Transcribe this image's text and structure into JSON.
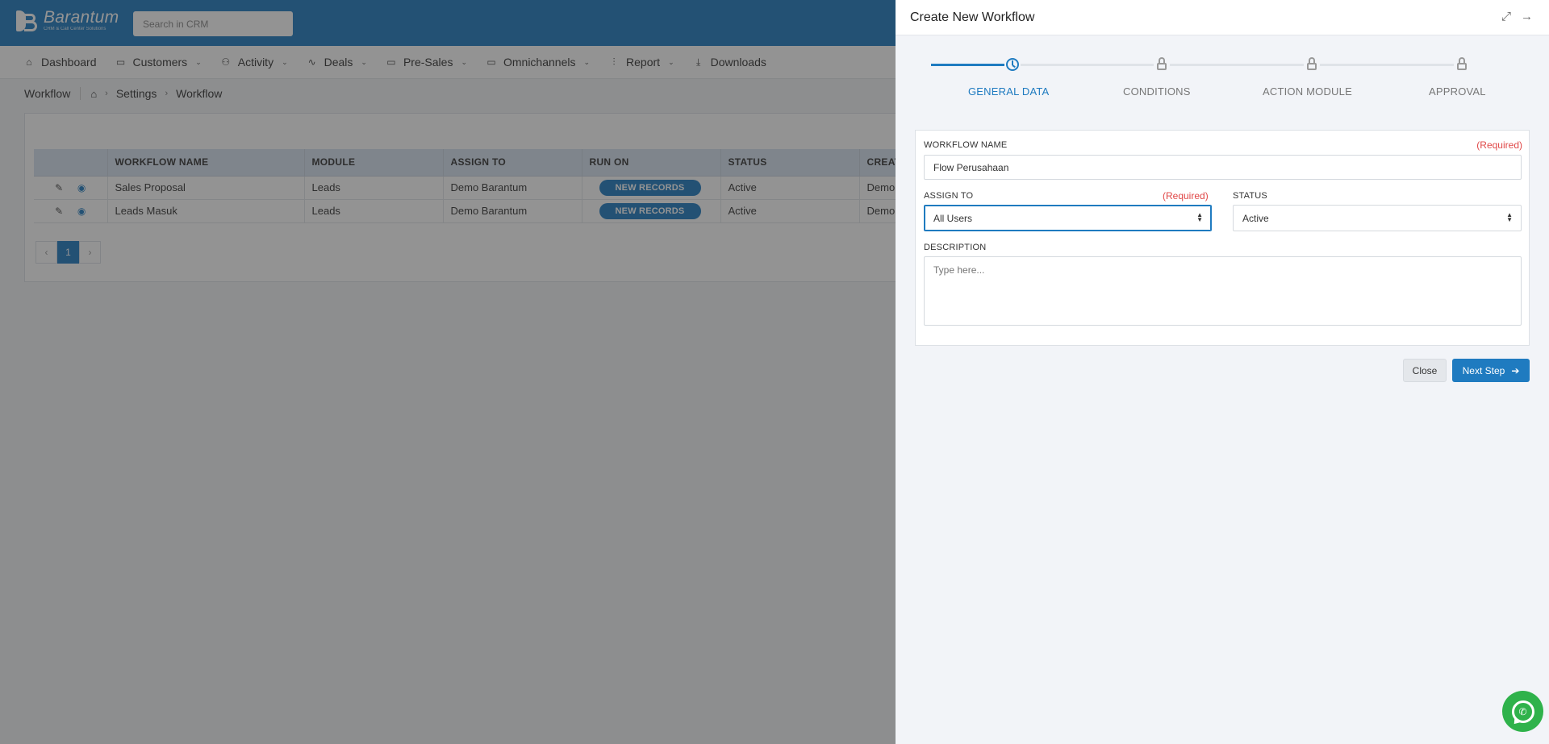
{
  "app": {
    "logo_name": "Barantum",
    "logo_tagline": "CRM & Call Center Solutions",
    "search_placeholder": "Search in CRM",
    "brand_color": "#1f7bc0"
  },
  "nav": [
    {
      "label": "Dashboard",
      "icon": "home-icon",
      "dropdown": false
    },
    {
      "label": "Customers",
      "icon": "folder-icon",
      "dropdown": true
    },
    {
      "label": "Activity",
      "icon": "users-icon",
      "dropdown": true
    },
    {
      "label": "Deals",
      "icon": "pulse-icon",
      "dropdown": true
    },
    {
      "label": "Pre-Sales",
      "icon": "folder-icon",
      "dropdown": true
    },
    {
      "label": "Omnichannels",
      "icon": "folder-icon",
      "dropdown": true
    },
    {
      "label": "Report",
      "icon": "bar-chart-icon",
      "dropdown": true
    },
    {
      "label": "Downloads",
      "icon": "download-icon",
      "dropdown": false
    }
  ],
  "breadcrumb": {
    "title": "Workflow",
    "items": [
      "Settings",
      "Workflow"
    ]
  },
  "table": {
    "headers": [
      "",
      "WORKFLOW NAME",
      "MODULE",
      "ASSIGN TO",
      "RUN ON",
      "STATUS",
      "CREAT"
    ],
    "rows": [
      {
        "name": "Sales Proposal",
        "module": "Leads",
        "assign_to": "Demo Barantum",
        "run_on": "NEW RECORDS",
        "status": "Active",
        "created": "Demo"
      },
      {
        "name": "Leads Masuk",
        "module": "Leads",
        "assign_to": "Demo Barantum",
        "run_on": "NEW RECORDS",
        "status": "Active",
        "created": "Demo"
      }
    ],
    "pagination": {
      "prev": "‹",
      "current": "1",
      "next": "›"
    }
  },
  "drawer": {
    "title": "Create New Workflow",
    "steps": [
      {
        "label": "GENERAL DATA",
        "icon": "clock-icon",
        "state": "current"
      },
      {
        "label": "CONDITIONS",
        "icon": "lock-icon",
        "state": "locked"
      },
      {
        "label": "ACTION MODULE",
        "icon": "lock-icon",
        "state": "locked"
      },
      {
        "label": "APPROVAL",
        "icon": "lock-icon",
        "state": "locked"
      }
    ],
    "form": {
      "workflow_name_label": "WORKFLOW NAME",
      "workflow_name_required": "(Required)",
      "workflow_name_value": "Flow Perusahaan",
      "assign_to_label": "ASSIGN TO",
      "assign_to_required": "(Required)",
      "assign_to_value": "All Users",
      "status_label": "STATUS",
      "status_value": "Active",
      "description_label": "DESCRIPTION",
      "description_placeholder": "Type here..."
    },
    "buttons": {
      "close": "Close",
      "next": "Next Step"
    }
  }
}
